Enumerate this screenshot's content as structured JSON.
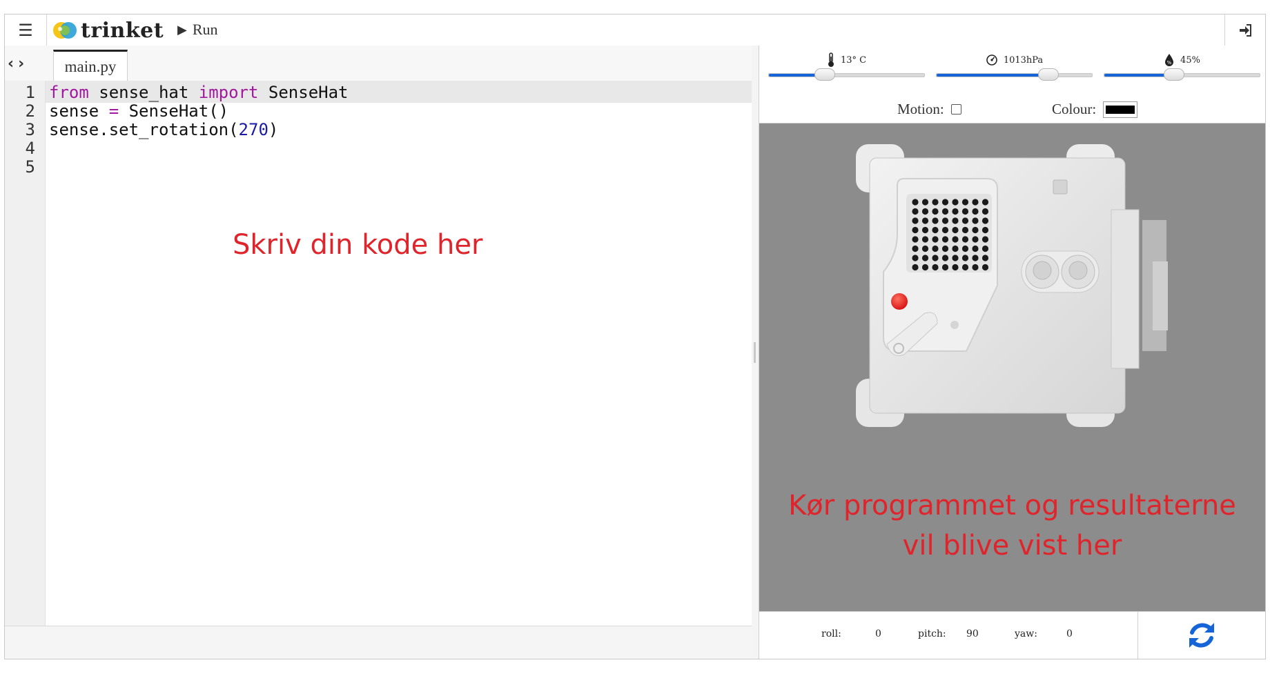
{
  "topbar": {
    "menu_icon": "hamburger-icon",
    "logo_text": "trinket",
    "run_label": "Run",
    "login_icon": "sign-in-icon"
  },
  "editor": {
    "file_tab": "main.py",
    "line_numbers": [
      "1",
      "2",
      "3",
      "4",
      "5"
    ],
    "code": {
      "line1": {
        "kw1": "from",
        "mid": " sense_hat ",
        "kw2": "import",
        "end": " SenseHat"
      },
      "line2": {
        "a": "sense ",
        "op": "=",
        "b": " SenseHat()"
      },
      "line3": {
        "a": "sense.set_rotation(",
        "num": "270",
        "b": ")"
      }
    },
    "hint": "Skriv din kode her"
  },
  "sensors": {
    "temperature": {
      "label": "13° C",
      "icon": "thermometer-icon",
      "level": 0.36
    },
    "pressure": {
      "label": "1013hPa",
      "icon": "gauge-icon",
      "level": 0.72
    },
    "humidity": {
      "label": "45%",
      "icon": "humidity-drop-icon",
      "level": 0.45
    },
    "motion_label": "Motion:",
    "colour_label": "Colour:",
    "colour_value": "#000000"
  },
  "output": {
    "hint_line1": "Kør programmet og resultaterne",
    "hint_line2": "vil blive vist her"
  },
  "orientation": {
    "roll_label": "roll:",
    "roll": "0",
    "pitch_label": "pitch:",
    "pitch": "90",
    "yaw_label": "yaw:",
    "yaw": "0",
    "refresh_icon": "refresh-icon"
  },
  "colors": {
    "accent": "#1565d8",
    "hint": "#e0242b",
    "stage": "#8c8c8c",
    "keyword": "#a0189e",
    "number": "#1a1aa6"
  }
}
